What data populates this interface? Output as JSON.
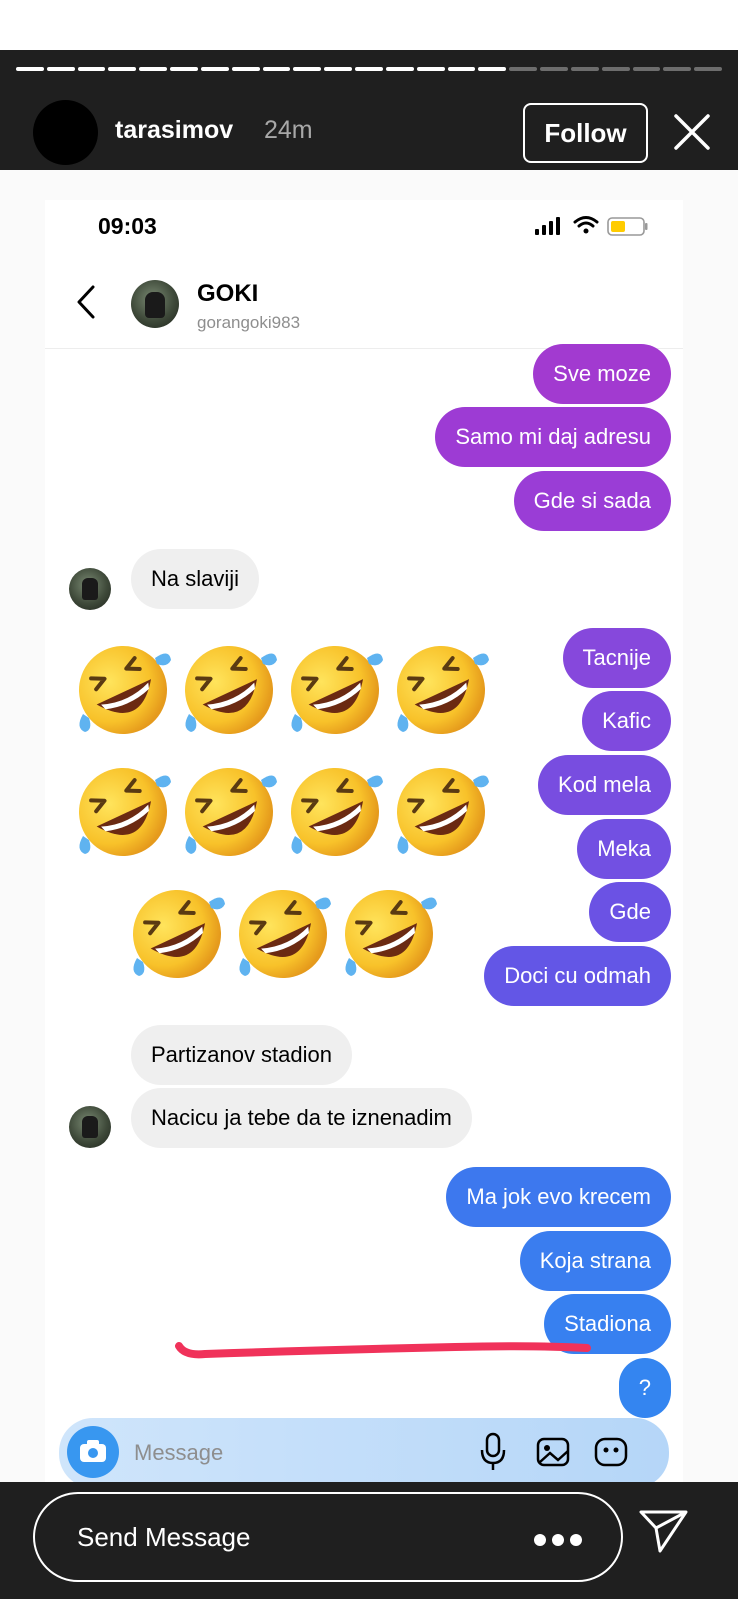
{
  "story": {
    "username": "tarasimov",
    "time_ago": "24m",
    "follow_label": "Follow",
    "progress_segments_total": 23,
    "progress_segments_done": 16
  },
  "phone": {
    "status_time": "09:03",
    "battery_color": "#ffcc00"
  },
  "thread": {
    "name": "GOKI",
    "handle": "gorangoki983"
  },
  "messages": [
    {
      "side": "out",
      "text": "Sve moze",
      "color": "#a23ad0"
    },
    {
      "side": "out",
      "text": "Samo mi daj adresu",
      "color": "#9d3bd4"
    },
    {
      "side": "out",
      "text": "Gde si sada",
      "color": "#9a3dd6"
    },
    {
      "side": "in",
      "text": "Na slaviji"
    },
    {
      "side": "in",
      "text": "🤣🤣🤣🤣🤣🤣🤣🤣🤣🤣🤣",
      "kind": "emoji",
      "count": 11
    },
    {
      "side": "out",
      "text": "Tacnije",
      "color": "#8648dc"
    },
    {
      "side": "out",
      "text": "Kafic",
      "color": "#7f4ade"
    },
    {
      "side": "out",
      "text": "Kod mela",
      "color": "#784de0"
    },
    {
      "side": "out",
      "text": "Meka",
      "color": "#7250e2"
    },
    {
      "side": "out",
      "text": "Gde",
      "color": "#6b52e4"
    },
    {
      "side": "out",
      "text": "Doci cu odmah",
      "color": "#6356e6"
    },
    {
      "side": "in",
      "text": "Partizanov stadion"
    },
    {
      "side": "in",
      "text": "Nacicu ja tebe da te iznenadim",
      "highlighted": true
    },
    {
      "side": "out",
      "text": "Ma jok evo krecem",
      "color": "#3d78ee"
    },
    {
      "side": "out",
      "text": "Koja strana",
      "color": "#3a7def"
    },
    {
      "side": "out",
      "text": "Stadiona",
      "color": "#3780f0"
    },
    {
      "side": "out",
      "text": "?",
      "color": "#3485f0"
    }
  ],
  "composer": {
    "placeholder": "Message"
  },
  "reply": {
    "placeholder": "Send Message"
  },
  "colors": {
    "story_bar": "#1f1f1f",
    "highlight_underline": "#f0325a",
    "incoming_bubble": "#efefef"
  },
  "icons": [
    "close-icon",
    "back-chevron-icon",
    "signal-icon",
    "wifi-icon",
    "battery-icon",
    "camera-icon",
    "mic-icon",
    "image-icon",
    "sticker-icon",
    "more-icon",
    "send-icon",
    "rofl-emoji"
  ]
}
